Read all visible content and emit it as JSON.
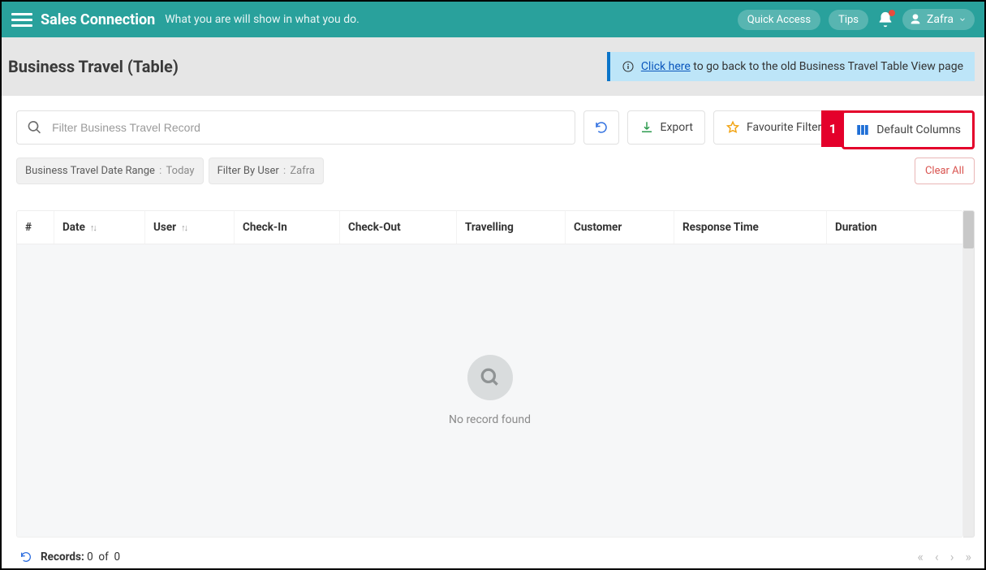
{
  "header": {
    "brand": "Sales Connection",
    "tagline": "What you are will show in what you do.",
    "quick_access": "Quick Access",
    "tips": "Tips",
    "user_name": "Zafra"
  },
  "page": {
    "title": "Business Travel (Table)",
    "notice_link_text": "Click here",
    "notice_rest": " to go back to the old Business Travel Table View page"
  },
  "toolbar": {
    "search_placeholder": "Filter Business Travel Record",
    "export_label": "Export",
    "favourite_label": "Favourite Filter",
    "default_columns_label": "Default Columns"
  },
  "callout": {
    "number": "1"
  },
  "filters": {
    "chips": [
      {
        "label": "Business Travel Date Range",
        "value": "Today"
      },
      {
        "label": "Filter By User",
        "value": "Zafra"
      }
    ],
    "clear_all": "Clear All"
  },
  "table": {
    "columns": [
      "#",
      "Date",
      "User",
      "Check-In",
      "Check-Out",
      "Travelling",
      "Customer",
      "Response Time",
      "Duration"
    ],
    "empty_text": "No record found"
  },
  "footer": {
    "records_label": "Records:",
    "count": "0",
    "of": "of",
    "total": "0"
  }
}
